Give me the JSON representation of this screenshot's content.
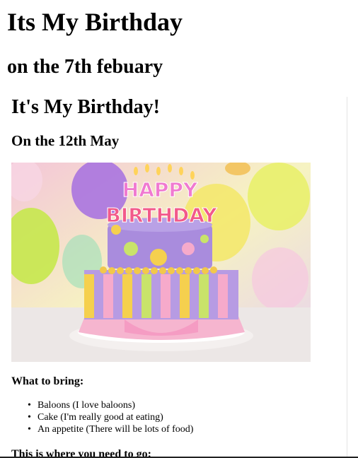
{
  "page": {
    "title": "Its My Birthday",
    "subtitle": "on the 7th febuary"
  },
  "frame": {
    "heading": "It's My Birthday!",
    "date": "On the 12th May",
    "image": {
      "banner_top": "HAPPY",
      "banner_bottom": "BIRTHDAY"
    },
    "bring_heading": "What to bring:",
    "bring_items": [
      "Baloons (I love baloons)",
      "Cake (I'm really good at eating)",
      "An appetite (There will be lots of food)"
    ],
    "location_heading": "This is where you need to go:"
  }
}
